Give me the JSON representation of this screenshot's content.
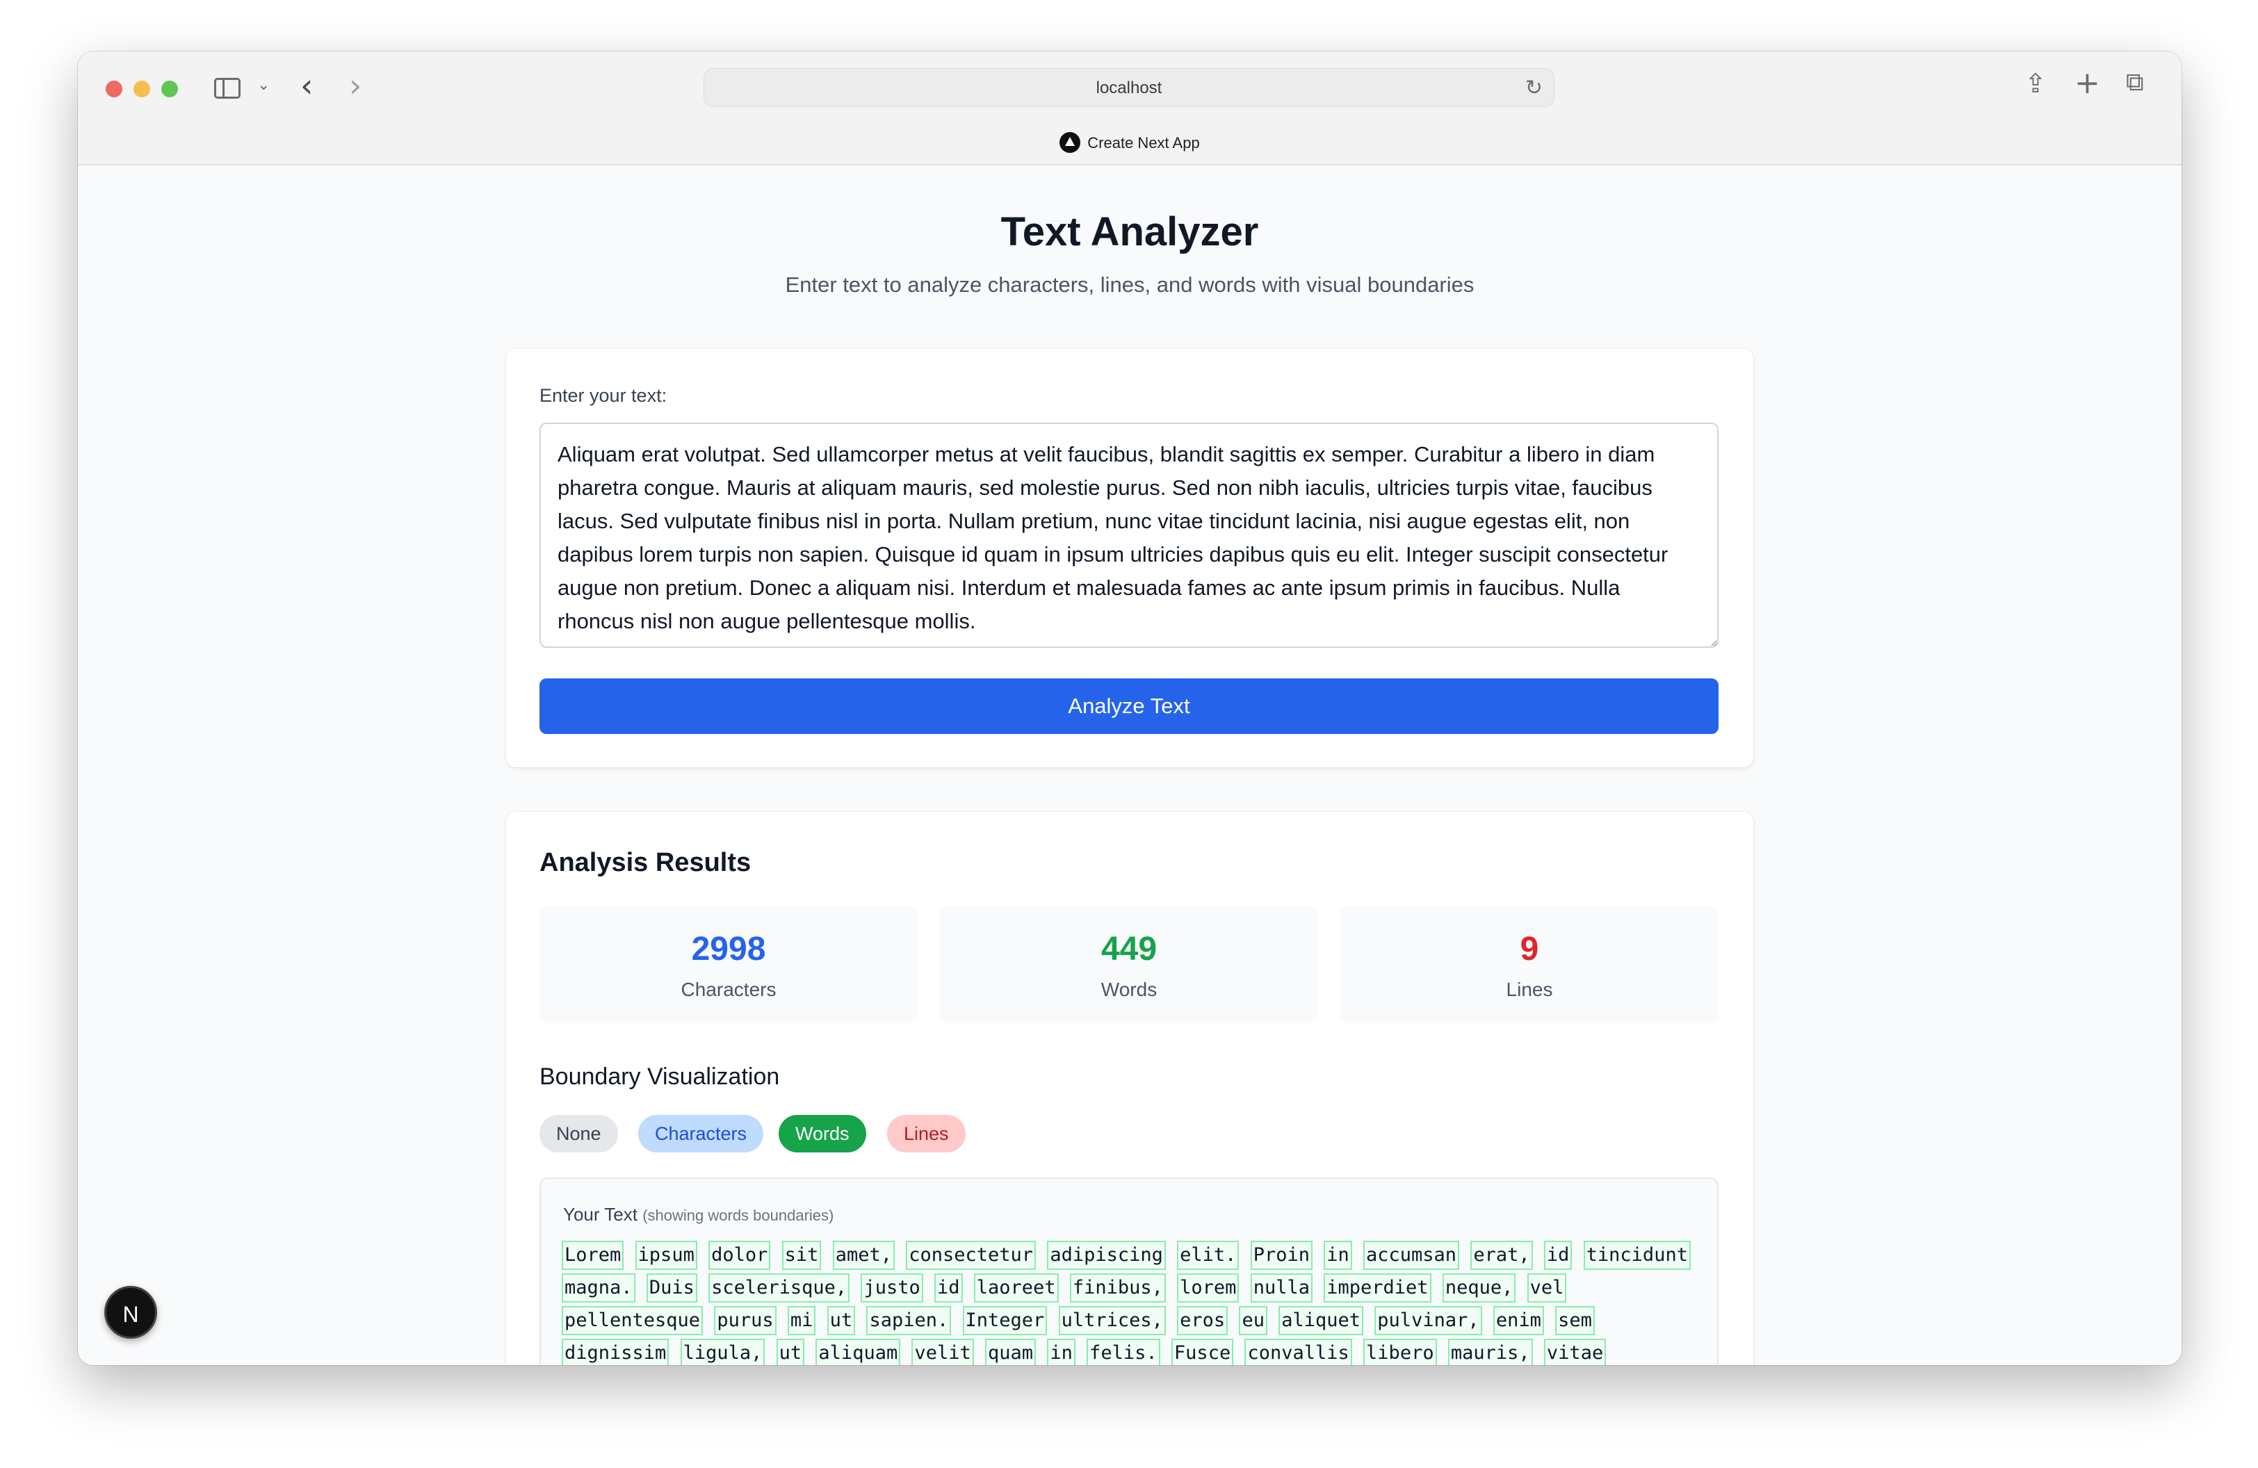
{
  "browser": {
    "url": "localhost",
    "tab_title": "Create Next App",
    "icons": {
      "sidebar": "sidebar-icon",
      "back": "chevron-left-icon",
      "forward": "chevron-right-icon",
      "reload": "reload-icon",
      "share": "share-icon",
      "new_tab": "plus-icon",
      "tabs": "tabs-overview-icon"
    }
  },
  "header": {
    "title": "Text Analyzer",
    "subtitle": "Enter text to analyze characters, lines, and words with visual boundaries"
  },
  "input": {
    "label": "Enter your text:",
    "value": "Aliquam erat volutpat. Sed ullamcorper metus at velit faucibus, blandit sagittis ex semper. Curabitur a libero in diam pharetra congue. Mauris at aliquam mauris, sed molestie purus. Sed non nibh iaculis, ultricies turpis vitae, faucibus lacus. Sed vulputate finibus nisl in porta. Nullam pretium, nunc vitae tincidunt lacinia, nisi augue egestas elit, non dapibus lorem turpis non sapien. Quisque id quam in ipsum ultricies dapibus quis eu elit. Integer suscipit consectetur augue non pretium. Donec a aliquam nisi. Interdum et malesuada fames ac ante ipsum primis in faucibus. Nulla rhoncus nisl non augue pellentesque mollis.",
    "button_label": "Analyze Text"
  },
  "results": {
    "title": "Analysis Results",
    "stats": [
      {
        "value": "2998",
        "label": "Characters",
        "color": "#2563eb"
      },
      {
        "value": "449",
        "label": "Words",
        "color": "#16a34a"
      },
      {
        "value": "9",
        "label": "Lines",
        "color": "#dc2626"
      }
    ],
    "boundary_title": "Boundary Visualization",
    "modes": [
      {
        "label": "None",
        "bg": "#e5e7eb",
        "fg": "#374151"
      },
      {
        "label": "Characters",
        "bg": "#bfdbfe",
        "fg": "#1d4ed8"
      },
      {
        "label": "Words",
        "bg": "#16a34a",
        "fg": "#ffffff"
      },
      {
        "label": "Lines",
        "bg": "#fecaca",
        "fg": "#b91c1c"
      }
    ],
    "selected_mode": "Words",
    "preview_heading": "Your Text",
    "preview_sub": "(showing words boundaries)",
    "preview_words": [
      "Lorem",
      "ipsum",
      "dolor",
      "sit",
      "amet,",
      "consectetur",
      "adipiscing",
      "elit.",
      "Proin",
      "in",
      "accumsan",
      "erat,",
      "id",
      "tincidunt",
      "magna.",
      "Duis",
      "scelerisque,",
      "justo",
      "id",
      "laoreet",
      "finibus,",
      "lorem",
      "nulla",
      "imperdiet",
      "neque,",
      "vel",
      "pellentesque",
      "purus",
      "mi",
      "ut",
      "sapien.",
      "Integer",
      "ultrices,",
      "eros",
      "eu",
      "aliquet",
      "pulvinar,",
      "enim",
      "sem",
      "dignissim",
      "ligula,",
      "ut",
      "aliquam",
      "velit",
      "quam",
      "in",
      "felis.",
      "Fusce",
      "convallis",
      "libero",
      "mauris,",
      "vitae"
    ]
  }
}
